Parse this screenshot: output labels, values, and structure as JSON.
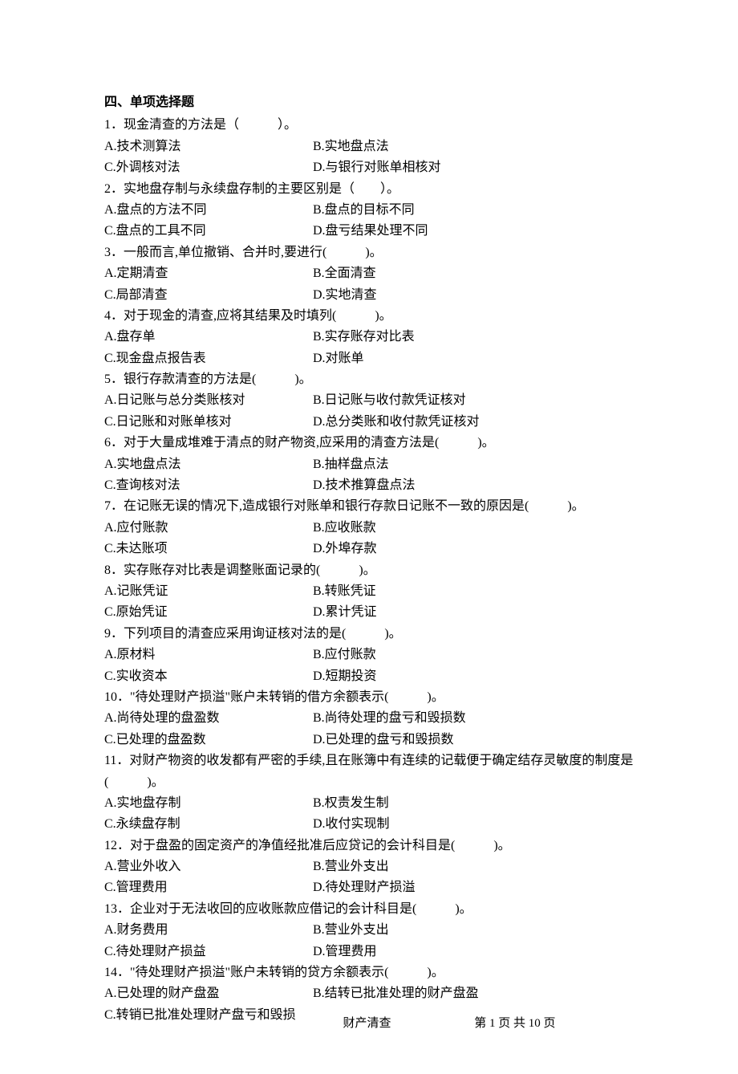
{
  "section_title": "四、单项选择题",
  "questions": [
    {
      "stem": "1．现金清查的方法是（　　　）。",
      "rows": [
        {
          "a": "A.技术测算法",
          "b": "B.实地盘点法"
        },
        {
          "a": "C.外调核对法",
          "b": "D.与银行对账单相核对"
        }
      ]
    },
    {
      "stem": "2．实地盘存制与永续盘存制的主要区别是（　　）。",
      "rows": [
        {
          "a": "A.盘点的方法不同",
          "b": "B.盘点的目标不同"
        },
        {
          "a": "C.盘点的工具不同",
          "b": "D.盘亏结果处理不同"
        }
      ]
    },
    {
      "stem": "3．一般而言,单位撤销、合并时,要进行(　　　)。",
      "rows": [
        {
          "a": "A.定期清查",
          "b": "B.全面清查"
        },
        {
          "a": "C.局部清查",
          "b": "D.实地清查"
        }
      ]
    },
    {
      "stem": "4．对于现金的清查,应将其结果及时填列(　　　)。",
      "rows": [
        {
          "a": "A.盘存单",
          "b": "B.实存账存对比表"
        },
        {
          "a": "C.现金盘点报告表",
          "b": "D.对账单"
        }
      ]
    },
    {
      "stem": "5．银行存款清查的方法是(　　　)。",
      "rows": [
        {
          "a": "A.日记账与总分类账核对",
          "b": "B.日记账与收付款凭证核对"
        },
        {
          "a": "C.日记账和对账单核对",
          "b": "D.总分类账和收付款凭证核对"
        }
      ]
    },
    {
      "stem": "6．对于大量成堆难于清点的财产物资,应采用的清查方法是(　　　)。",
      "rows": [
        {
          "a": "A.实地盘点法",
          "b": "B.抽样盘点法"
        },
        {
          "a": "C.查询核对法",
          "b": "D.技术推算盘点法"
        }
      ]
    },
    {
      "stem": "7．在记账无误的情况下,造成银行对账单和银行存款日记账不一致的原因是(　　　)。",
      "rows": [
        {
          "a": "A.应付账款",
          "b": "B.应收账款"
        },
        {
          "a": "C.未达账项",
          "b": "D.外埠存款"
        }
      ]
    },
    {
      "stem": "8．实存账存对比表是调整账面记录的(　　　)。",
      "rows": [
        {
          "a": "A.记账凭证",
          "b": "B.转账凭证"
        },
        {
          "a": "C.原始凭证",
          "b": "D.累计凭证"
        }
      ]
    },
    {
      "stem": "9．下列项目的清查应采用询证核对法的是(　　　)。",
      "rows": [
        {
          "a": "A.原材料",
          "b": "B.应付账款"
        },
        {
          "a": "C.实收资本",
          "b": "D.短期投资"
        }
      ]
    },
    {
      "stem": "10．\"待处理财产损溢\"账户未转销的借方余额表示(　　　)。",
      "rows": [
        {
          "a": "A.尚待处理的盘盈数",
          "b": "B.尚待处理的盘亏和毁损数"
        },
        {
          "a": "C.已处理的盘盈数",
          "b": "D.已处理的盘亏和毁损数"
        }
      ]
    },
    {
      "stem": "11．对财产物资的收发都有严密的手续,且在账簿中有连续的记载便于确定结存灵敏度的制度是(　　　)。",
      "rows": [
        {
          "a": "A.实地盘存制",
          "b": "B.权责发生制"
        },
        {
          "a": "C.永续盘存制",
          "b": "D.收付实现制"
        }
      ]
    },
    {
      "stem": "12．对于盘盈的固定资产的净值经批准后应贷记的会计科目是(　　　)。",
      "rows": [
        {
          "a": "A.营业外收入",
          "b": "B.营业外支出"
        },
        {
          "a": "C.管理费用",
          "b": "D.待处理财产损溢"
        }
      ]
    },
    {
      "stem": "13．企业对于无法收回的应收账款应借记的会计科目是(　　　)。",
      "rows": [
        {
          "a": "A.财务费用",
          "b": "B.营业外支出"
        },
        {
          "a": "C.待处理财产损益",
          "b": "D.管理费用"
        }
      ]
    },
    {
      "stem": "14．\"待处理财产损溢\"账户未转销的贷方余额表示(　　　)。",
      "rows": [
        {
          "a": "A.已处理的财产盘盈",
          "b": "B.结转已批准处理的财产盘盈"
        },
        {
          "a": "C.转销已批准处理财产盘亏和毁损",
          "b": ""
        }
      ]
    }
  ],
  "footer": {
    "left": "财产清查",
    "right": "第 1 页 共 10 页"
  }
}
